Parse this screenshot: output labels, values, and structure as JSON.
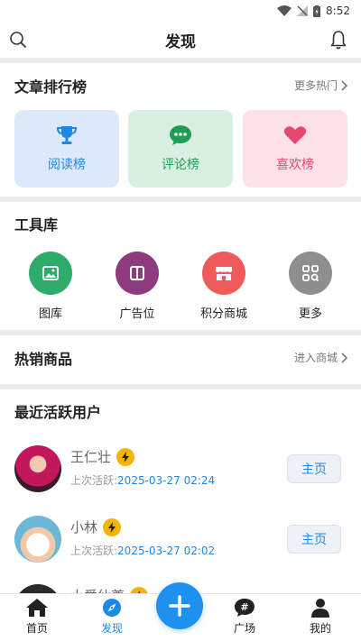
{
  "status_bar": {
    "time": "8:52"
  },
  "header": {
    "title": "发现"
  },
  "ranking": {
    "title": "文章排行榜",
    "more": "更多热门",
    "cards": [
      {
        "label": "阅读榜",
        "icon": "trophy-icon",
        "bg": "#dbe9fb",
        "color": "#1e88e5"
      },
      {
        "label": "评论榜",
        "icon": "comment-icon",
        "bg": "#d9efe2",
        "color": "#1f9d55"
      },
      {
        "label": "喜欢榜",
        "icon": "heart-icon",
        "bg": "#fce1e8",
        "color": "#e8476e"
      }
    ]
  },
  "tools": {
    "title": "工具库",
    "items": [
      {
        "label": "图库",
        "icon": "image-icon",
        "color": "#2eaa6a"
      },
      {
        "label": "广告位",
        "icon": "book-icon",
        "color": "#8e3c7e"
      },
      {
        "label": "积分商城",
        "icon": "store-icon",
        "color": "#ef5a5a"
      },
      {
        "label": "更多",
        "icon": "grid-search-icon",
        "color": "#8e8e8e"
      }
    ]
  },
  "hot": {
    "title": "热销商品",
    "more": "进入商城"
  },
  "users": {
    "title": "最近活跃用户",
    "active_prefix": "上次活跃:",
    "button_label": "主页",
    "list": [
      {
        "name": "王仁壮",
        "time": "2025-03-27 02:24"
      },
      {
        "name": "小林",
        "time": "2025-03-27 02:02"
      },
      {
        "name": "大爱仙尊",
        "time": ""
      }
    ]
  },
  "tabbar": {
    "items": [
      {
        "label": "首页",
        "icon": "home-icon"
      },
      {
        "label": "发现",
        "icon": "compass-icon"
      },
      {
        "label": "广场",
        "icon": "hashtag-chat-icon"
      },
      {
        "label": "我的",
        "icon": "user-icon"
      }
    ],
    "active_color": "#1e88e5"
  }
}
